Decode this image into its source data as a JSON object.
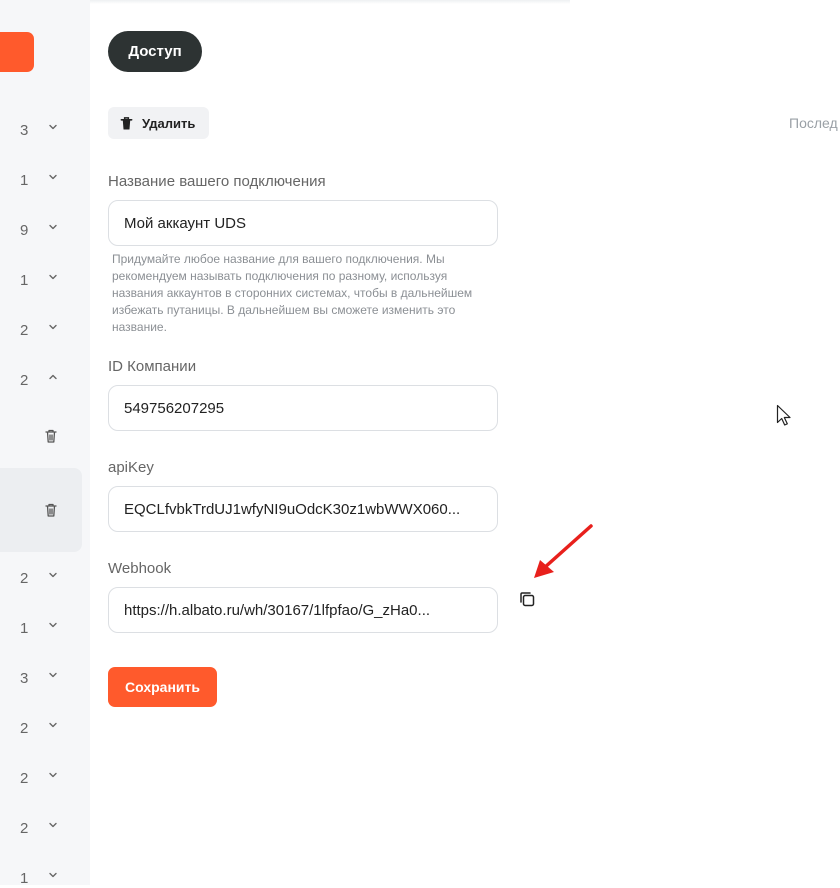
{
  "sidebar": {
    "rows": [
      {
        "count": "3",
        "chevron": "down"
      },
      {
        "count": "1",
        "chevron": "down"
      },
      {
        "count": "9",
        "chevron": "down"
      },
      {
        "count": "1",
        "chevron": "down"
      },
      {
        "count": "2",
        "chevron": "down"
      },
      {
        "count": "2",
        "chevron": "up"
      },
      {
        "count": "2",
        "chevron": "down"
      },
      {
        "count": "1",
        "chevron": "down"
      },
      {
        "count": "3",
        "chevron": "down"
      },
      {
        "count": "2",
        "chevron": "down"
      },
      {
        "count": "2",
        "chevron": "down"
      },
      {
        "count": "2",
        "chevron": "down"
      },
      {
        "count": "1",
        "chevron": "down"
      }
    ],
    "icons": [
      "chevron-down-icon",
      "chevron-up-icon",
      "trash-icon"
    ]
  },
  "header": {
    "access_label": "Доступ",
    "delete_label": "Удалить",
    "last_label": "Послед"
  },
  "form": {
    "name_label": "Название вашего подключения",
    "name_value": "Мой аккаунт UDS",
    "name_hint": "Придумайте любое название для вашего подключения. Мы рекомендуем называть подключения по разному, используя названия аккаунтов в сторонних системах, чтобы в дальнейшем избежать путаницы. В дальнейшем вы сможете изменить это название.",
    "company_label": "ID Компании",
    "company_value": "549756207295",
    "apikey_label": "apiKey",
    "apikey_value": "EQCLfvbkTrdUJ1wfyNI9uOdcK30z1wbWWX060...",
    "webhook_label": "Webhook",
    "webhook_value": "https://h.albato.ru/wh/30167/1lfpfao/G_zHa0...",
    "save_label": "Сохранить"
  },
  "colors": {
    "accent": "#ff5a2c",
    "dark_button": "#2d3333",
    "annotation_arrow": "#e8201c"
  }
}
